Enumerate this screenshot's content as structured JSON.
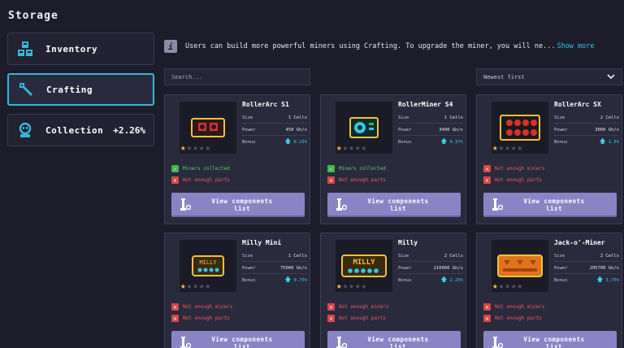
{
  "title": "Storage",
  "sidebar": {
    "items": [
      {
        "label": "Inventory",
        "icon": "inventory-icon",
        "active": false,
        "badge": ""
      },
      {
        "label": "Crafting",
        "icon": "wrench-icon",
        "active": true,
        "badge": ""
      },
      {
        "label": "Collection",
        "icon": "robot-icon",
        "active": false,
        "badge": "+2.26%"
      }
    ]
  },
  "info": {
    "icon": "info-icon",
    "text": "Users can build more powerful miners using Crafting. To upgrade the miner, you will ne...",
    "show_more": "Show more"
  },
  "search": {
    "placeholder": "Search..."
  },
  "sort": {
    "value": "Newest first"
  },
  "labels": {
    "size": "Size",
    "power": "Power",
    "bonus": "Bonus",
    "view_line1": "View components",
    "view_line2": "list"
  },
  "colors": {
    "accent": "#35b8d6",
    "button": "#8a83c4",
    "ok": "#55d265",
    "bad": "#ec5a5a",
    "star": "#f0c23c"
  },
  "cards": [
    {
      "name": "RollerArc S1",
      "size": "1 Cells",
      "power": "450 Gh/s",
      "bonus": "0.15%",
      "stars": 1,
      "status": [
        {
          "ok": true,
          "text": "Miners collected"
        },
        {
          "ok": false,
          "text": "Not enough parts"
        }
      ]
    },
    {
      "name": "RollerMiner S4",
      "size": "1 Cells",
      "power": "3400 Gh/s",
      "bonus": "0.37%",
      "stars": 1,
      "status": [
        {
          "ok": true,
          "text": "Miners collected"
        },
        {
          "ok": false,
          "text": "Not enough parts"
        }
      ]
    },
    {
      "name": "RollerArc SX",
      "size": "2 Cells",
      "power": "3000 Gh/s",
      "bonus": "1.5%",
      "stars": 1,
      "status": [
        {
          "ok": false,
          "text": "Not enough miners"
        },
        {
          "ok": false,
          "text": "Not enough parts"
        }
      ]
    },
    {
      "name": "Milly Mini",
      "size": "1 Cells",
      "power": "75000 Gh/s",
      "bonus": "0.75%",
      "stars": 1,
      "status": [
        {
          "ok": false,
          "text": "Not enough miners"
        },
        {
          "ok": false,
          "text": "Not enough parts"
        }
      ]
    },
    {
      "name": "Milly",
      "size": "2 Cells",
      "power": "210000 Gh/s",
      "bonus": "2.25%",
      "stars": 1,
      "status": [
        {
          "ok": false,
          "text": "Not enough miners"
        },
        {
          "ok": false,
          "text": "Not enough parts"
        }
      ]
    },
    {
      "name": "Jack-o'-Miner",
      "size": "2 Cells",
      "power": "295700 Gh/s",
      "bonus": "3.75%",
      "stars": 1,
      "status": [
        {
          "ok": false,
          "text": "Not enough miners"
        },
        {
          "ok": false,
          "text": "Not enough parts"
        }
      ]
    }
  ]
}
